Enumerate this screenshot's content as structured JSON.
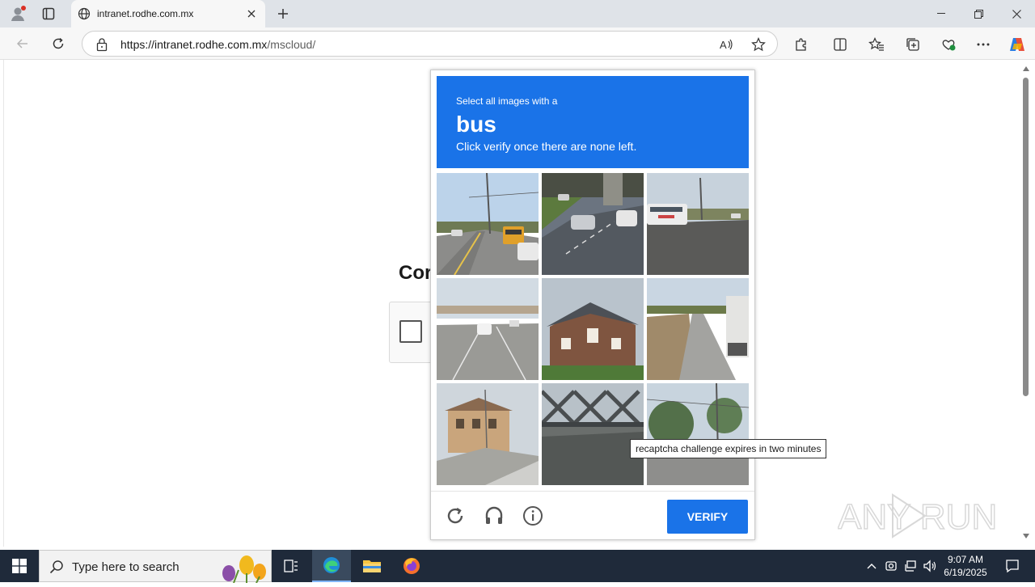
{
  "browser": {
    "tab_title": "intranet.rodhe.com.mx",
    "url_host": "https://intranet.rodhe.com.mx",
    "url_path": "/mscloud/"
  },
  "background_page": {
    "heading_partial": "Cor"
  },
  "captcha": {
    "instruction_line1": "Select all images with a",
    "keyword": "bus",
    "instruction_line3": "Click verify once there are none left.",
    "verify_label": "VERIFY",
    "tooltip": "recaptcha challenge expires in two minutes",
    "tiles": [
      {
        "id": 1
      },
      {
        "id": 2
      },
      {
        "id": 3
      },
      {
        "id": 4
      },
      {
        "id": 5
      },
      {
        "id": 6
      },
      {
        "id": 7
      },
      {
        "id": 8
      },
      {
        "id": 9
      }
    ]
  },
  "watermark": {
    "text": "ANY RUN"
  },
  "taskbar": {
    "search_placeholder": "Type here to search",
    "time": "9:07 AM",
    "date": "6/19/2025"
  },
  "colors": {
    "captcha_blue": "#1a73e8",
    "taskbar": "#1f2a3a"
  }
}
